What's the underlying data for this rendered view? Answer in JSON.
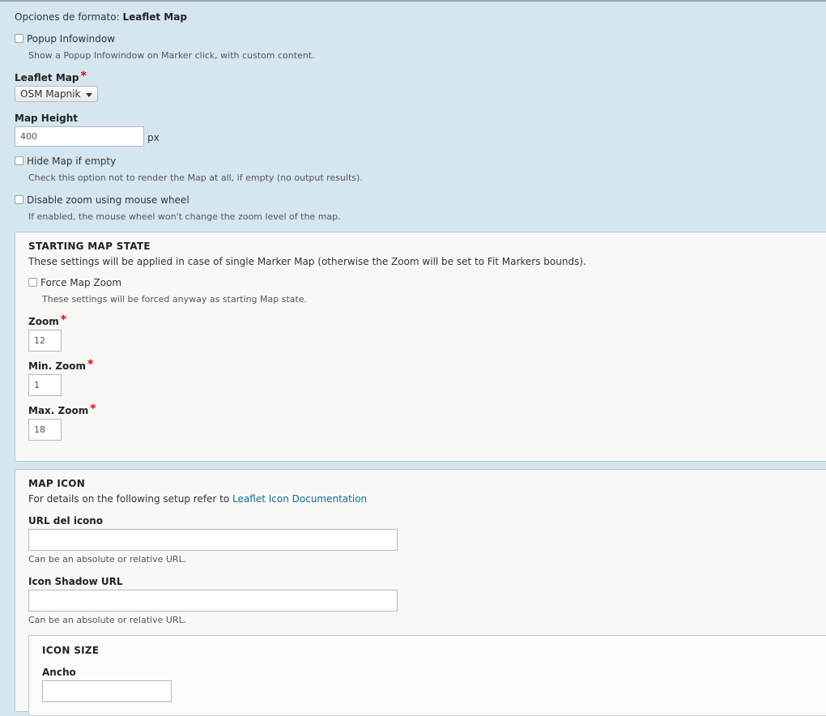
{
  "header": {
    "prefix": "Opciones de formato:",
    "format_name": "Leaflet Map"
  },
  "popup": {
    "label": "Popup Infowindow",
    "description": "Show a Popup Infowindow on Marker click, with custom content."
  },
  "leaflet_map": {
    "label": "Leaflet Map",
    "required_mark": "*",
    "selected": "OSM Mapnik"
  },
  "map_height": {
    "label": "Map Height",
    "value": "400",
    "unit": "px"
  },
  "hide_empty": {
    "label": "Hide Map if empty",
    "description": "Check this option not to render the Map at all, if empty (no output results)."
  },
  "disable_zoom": {
    "label": "Disable zoom using mouse wheel",
    "description": "If enabled, the mouse wheel won't change the zoom level of the map."
  },
  "starting_state": {
    "title": "STARTING MAP STATE",
    "description": "These settings will be applied in case of single Marker Map (otherwise the Zoom will be set to Fit Markers bounds).",
    "force_zoom": {
      "label": "Force Map Zoom",
      "description": "These settings will be forced anyway as starting Map state."
    },
    "zoom": {
      "label": "Zoom",
      "required_mark": "*",
      "value": "12"
    },
    "min_zoom": {
      "label": "Min. Zoom",
      "required_mark": "*",
      "value": "1"
    },
    "max_zoom": {
      "label": "Max. Zoom",
      "required_mark": "*",
      "value": "18"
    }
  },
  "map_icon": {
    "title": "MAP ICON",
    "description_prefix": "For details on the following setup refer to",
    "doc_link": "Leaflet Icon Documentation",
    "icon_url": {
      "label": "URL del icono",
      "value": "",
      "description": "Can be an absolute or relative URL."
    },
    "shadow_url": {
      "label": "Icon Shadow URL",
      "value": "",
      "description": "Can be an absolute or relative URL."
    },
    "icon_size": {
      "title": "ICON SIZE",
      "width_label": "Ancho",
      "width_value": ""
    }
  },
  "colors": {
    "background": "#d4e7f0",
    "panel": "#f8f8f6",
    "link": "#0f6c9b",
    "required": "#e00000"
  }
}
